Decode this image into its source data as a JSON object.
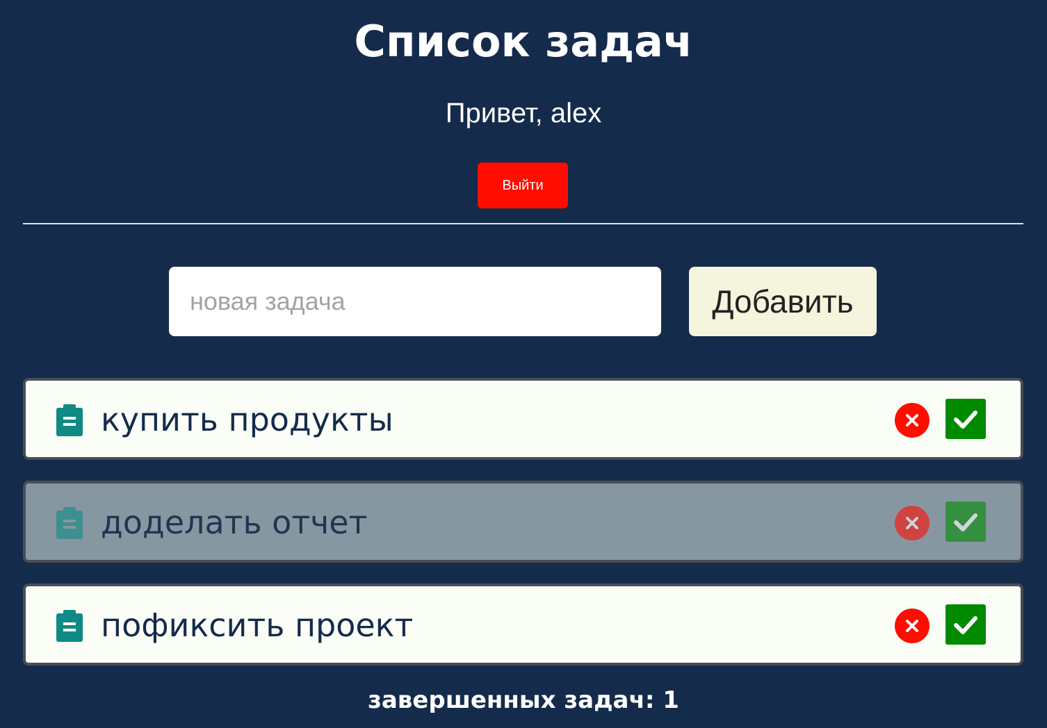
{
  "theme": {
    "background": "#142b4b",
    "logout_color": "#ff0d00",
    "add_button_color": "#f5f4dc",
    "delete_color": "#ff0d00",
    "check_color": "#008a00",
    "task_icon_color": "#0f8a84"
  },
  "header": {
    "title": "Список задач",
    "greeting": "Привет, alex",
    "logout_label": "Выйти"
  },
  "form": {
    "input_placeholder": "новая задача",
    "input_value": "",
    "add_label": "Добавить"
  },
  "tasks": [
    {
      "text": "купить продукты",
      "icon": "clipboard-icon",
      "done": false
    },
    {
      "text": "доделать отчет",
      "icon": "clipboard-icon",
      "done": true
    },
    {
      "text": "пофиксить проект",
      "icon": "clipboard-icon",
      "done": false
    }
  ],
  "footer": {
    "completed_label": "завершенных задач: 1"
  }
}
